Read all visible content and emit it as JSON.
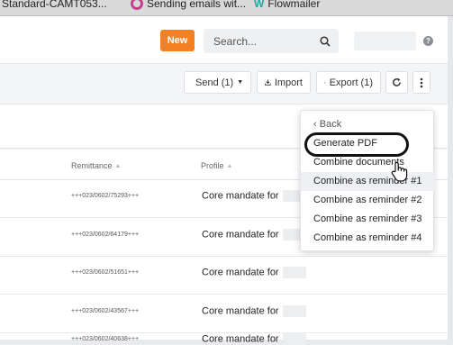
{
  "bookmarks": [
    {
      "label": "Standard-CAMT053...",
      "icon": "document-icon"
    },
    {
      "label": "Sending emails wit...",
      "icon": "ring-icon",
      "color": "#c2418f"
    },
    {
      "label": "Flowmailer",
      "icon": "flowmailer-logo-icon",
      "color": "#2aa5a0"
    }
  ],
  "header": {
    "new_label": "New",
    "new_color": "#f48024",
    "search": {
      "placeholder": "Search...",
      "value": ""
    }
  },
  "toolbar": {
    "send_label": "Send (1)",
    "import_label": "Import",
    "export_label": "Export (1)"
  },
  "table": {
    "columns": [
      "Remittance",
      "Profile"
    ],
    "rows": [
      {
        "remittance": "+++023/0602/75293+++",
        "profile": "Core mandate for"
      },
      {
        "remittance": "+++023/0602/64179+++",
        "profile": "Core mandate for"
      },
      {
        "remittance": "+++023/0602/51651+++",
        "profile": "Core mandate for"
      },
      {
        "remittance": "+++023/0602/43567+++",
        "profile": "Core mandate for"
      },
      {
        "remittance": "+++023/0602/40638+++",
        "profile": "Core mandate for"
      }
    ]
  },
  "menu": {
    "back_label": "Back",
    "items": [
      "Generate PDF",
      "Combine documents",
      "Combine as reminder #1",
      "Combine as reminder #2",
      "Combine as reminder #3",
      "Combine as reminder #4"
    ]
  }
}
